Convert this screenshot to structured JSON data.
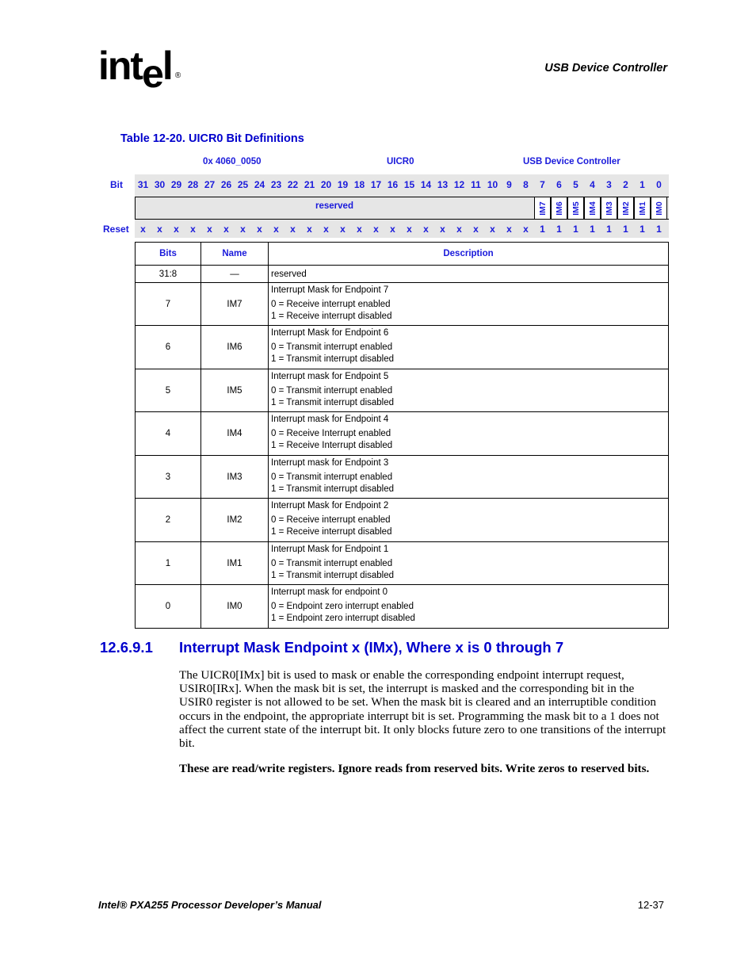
{
  "header": {
    "logo_text_main": "int",
    "logo_text_e": "e",
    "logo_text_l": "l",
    "logo_reg": "®",
    "section_title": "USB Device Controller"
  },
  "table": {
    "title": "Table 12-20. UICR0 Bit Definitions",
    "address": "0x 4060_0050",
    "register": "UICR0",
    "unit": "USB Device Controller",
    "bit_label": "Bit",
    "reset_label": "Reset",
    "bits": [
      "31",
      "30",
      "29",
      "28",
      "27",
      "26",
      "25",
      "24",
      "23",
      "22",
      "21",
      "20",
      "19",
      "18",
      "17",
      "16",
      "15",
      "14",
      "13",
      "12",
      "11",
      "10",
      "9",
      "8",
      "7",
      "6",
      "5",
      "4",
      "3",
      "2",
      "1",
      "0"
    ],
    "reserved_field_label": "reserved",
    "im_fields": [
      "IM7",
      "IM6",
      "IM5",
      "IM4",
      "IM3",
      "IM2",
      "IM1",
      "IM0"
    ],
    "reset_values": [
      "x",
      "x",
      "x",
      "x",
      "x",
      "x",
      "x",
      "x",
      "x",
      "x",
      "x",
      "x",
      "x",
      "x",
      "x",
      "x",
      "x",
      "x",
      "x",
      "x",
      "x",
      "x",
      "x",
      "x",
      "1",
      "1",
      "1",
      "1",
      "1",
      "1",
      "1",
      "1"
    ],
    "columns": {
      "bits": "Bits",
      "name": "Name",
      "description": "Description"
    },
    "rows": [
      {
        "bits": "31:8",
        "name": "—",
        "title": "reserved",
        "line0": "",
        "line1": ""
      },
      {
        "bits": "7",
        "name": "IM7",
        "title": "Interrupt Mask for Endpoint 7",
        "line0": "0 =  Receive interrupt enabled",
        "line1": "1 =  Receive interrupt disabled"
      },
      {
        "bits": "6",
        "name": "IM6",
        "title": "Interrupt Mask for Endpoint 6",
        "line0": "0 =  Transmit interrupt enabled",
        "line1": "1 =  Transmit interrupt disabled"
      },
      {
        "bits": "5",
        "name": "IM5",
        "title": "Interrupt mask for Endpoint 5",
        "line0": "0 =  Transmit interrupt enabled",
        "line1": "1 =  Transmit interrupt disabled"
      },
      {
        "bits": "4",
        "name": "IM4",
        "title": "Interrupt mask for Endpoint 4",
        "line0": "0 =  Receive Interrupt enabled",
        "line1": "1 =  Receive Interrupt disabled"
      },
      {
        "bits": "3",
        "name": "IM3",
        "title": "Interrupt mask for Endpoint 3",
        "line0": "0 =  Transmit interrupt enabled",
        "line1": "1 =  Transmit interrupt disabled"
      },
      {
        "bits": "2",
        "name": "IM2",
        "title": "Interrupt Mask for Endpoint 2",
        "line0": "0 =  Receive interrupt enabled",
        "line1": "1 =  Receive interrupt disabled"
      },
      {
        "bits": "1",
        "name": "IM1",
        "title": "Interrupt Mask for Endpoint 1",
        "line0": "0 =  Transmit interrupt enabled",
        "line1": "1 =  Transmit interrupt disabled"
      },
      {
        "bits": "0",
        "name": "IM0",
        "title": "Interrupt mask for endpoint 0",
        "line0": "0 =  Endpoint zero interrupt enabled",
        "line1": "1 =  Endpoint zero interrupt disabled"
      }
    ]
  },
  "section": {
    "number": "12.6.9.1",
    "title": "Interrupt Mask Endpoint x (IMx), Where x is 0 through 7",
    "paragraph": "The UICR0[IMx] bit is used to mask or enable the corresponding endpoint interrupt request, USIR0[IRx]. When the mask bit is set, the interrupt is masked and the corresponding bit in the USIR0 register is not allowed to be set. When the mask bit is cleared and an interruptible condition occurs in the endpoint, the appropriate interrupt bit is set. Programming the mask bit to a 1 does not affect the current state of the interrupt bit. It only blocks future zero to one transitions of the interrupt bit.",
    "note": "These are read/write registers. Ignore reads from reserved bits. Write zeros to reserved bits."
  },
  "footer": {
    "manual_title": "Intel® PXA255 Processor Developer’s Manual",
    "page_number": "12-37"
  }
}
